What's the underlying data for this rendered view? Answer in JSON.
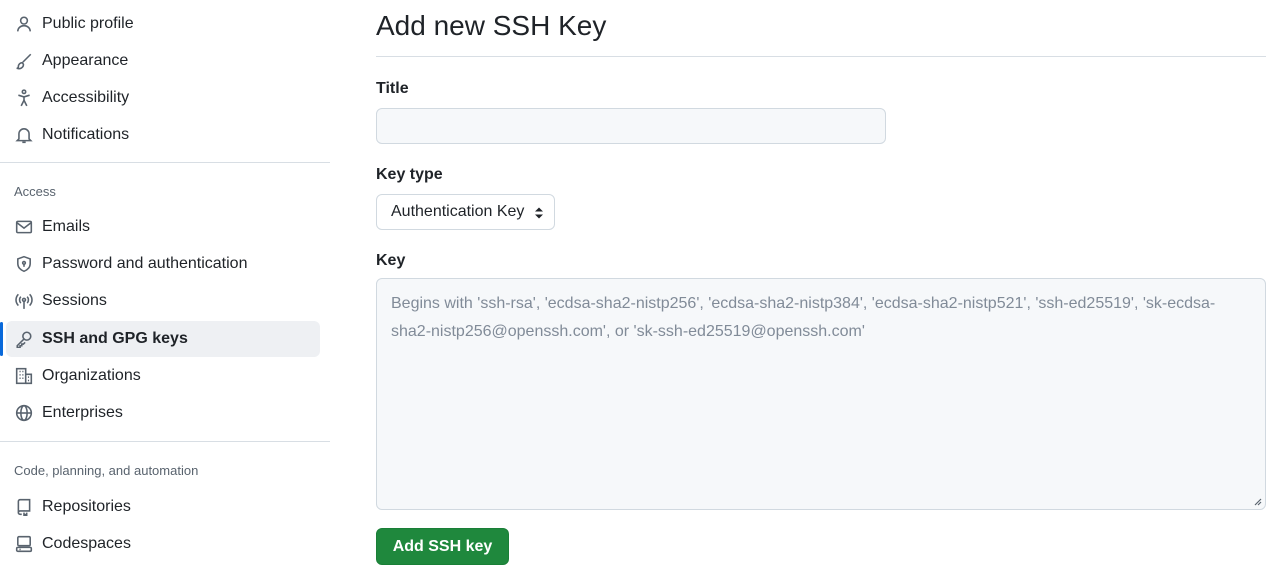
{
  "sidebar": {
    "top_items": [
      {
        "label": "Public profile",
        "icon": "person-icon"
      },
      {
        "label": "Appearance",
        "icon": "paintbrush-icon"
      },
      {
        "label": "Accessibility",
        "icon": "accessibility-icon"
      },
      {
        "label": "Notifications",
        "icon": "bell-icon"
      }
    ],
    "access_heading": "Access",
    "access_items": [
      {
        "label": "Emails",
        "icon": "mail-icon"
      },
      {
        "label": "Password and authentication",
        "icon": "shield-lock-icon"
      },
      {
        "label": "Sessions",
        "icon": "broadcast-icon"
      },
      {
        "label": "SSH and GPG keys",
        "icon": "key-icon",
        "active": true
      },
      {
        "label": "Organizations",
        "icon": "organization-icon"
      },
      {
        "label": "Enterprises",
        "icon": "globe-icon"
      }
    ],
    "code_heading": "Code, planning, and automation",
    "code_items": [
      {
        "label": "Repositories",
        "icon": "repo-icon"
      },
      {
        "label": "Codespaces",
        "icon": "codespaces-icon"
      }
    ]
  },
  "main": {
    "title": "Add new SSH Key",
    "title_label": "Title",
    "title_value": "",
    "key_type_label": "Key type",
    "key_type_value": "Authentication Key",
    "key_label": "Key",
    "key_placeholder": "Begins with 'ssh-rsa', 'ecdsa-sha2-nistp256', 'ecdsa-sha2-nistp384', 'ecdsa-sha2-nistp521', 'ssh-ed25519', 'sk-ecdsa-sha2-nistp256@openssh.com', or 'sk-ssh-ed25519@openssh.com'",
    "submit_label": "Add SSH key"
  },
  "colors": {
    "accent": "#0969da",
    "primary_button": "#1f883d",
    "active_bg": "#eef0f3"
  }
}
